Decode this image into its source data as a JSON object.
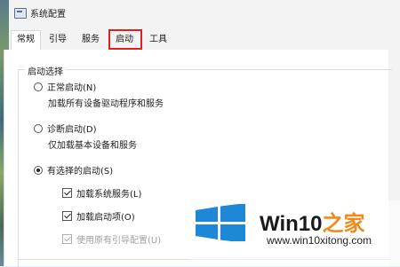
{
  "window": {
    "title": "系统配置",
    "app_icon": "msconfig-icon"
  },
  "tabs": [
    {
      "label": "常规",
      "active": true
    },
    {
      "label": "引导",
      "active": false
    },
    {
      "label": "服务",
      "active": false
    },
    {
      "label": "启动",
      "active": false,
      "highlighted": true
    },
    {
      "label": "工具",
      "active": false
    }
  ],
  "startup": {
    "group_label": "启动选择",
    "options": [
      {
        "label": "正常启动(N)",
        "description": "加载所有设备驱动程序和服务",
        "selected": false
      },
      {
        "label": "诊断启动(D)",
        "description": "仅加载基本设备和服务",
        "selected": false
      },
      {
        "label": "有选择的启动(S)",
        "selected": true
      }
    ],
    "selective": [
      {
        "label": "加载系统服务(L)",
        "checked": true,
        "enabled": true
      },
      {
        "label": "加载启动项(O)",
        "checked": true,
        "enabled": true
      },
      {
        "label": "使用原有引导配置(U)",
        "checked": true,
        "enabled": false
      }
    ]
  },
  "watermark": {
    "brand_main": "Win10",
    "brand_accent": "之家",
    "url": "www.win10xitong.com"
  },
  "colors": {
    "highlight": "#e02020",
    "watermark_accent": "#f08a1c",
    "windows_blue": "#1e88d8"
  }
}
